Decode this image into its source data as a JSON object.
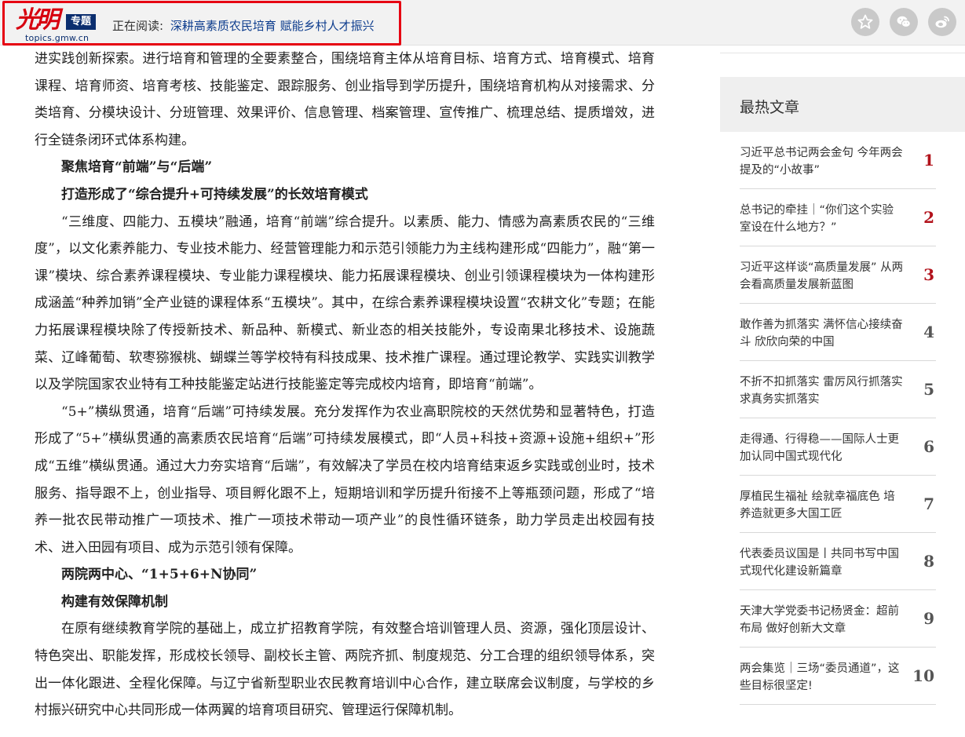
{
  "header": {
    "logo_calligraphy": "光明",
    "logo_tag": "专题",
    "logo_domain": "topics.gmw.cn",
    "reading_label": "正在阅读:",
    "reading_title": "深耕高素质农民培育 赋能乡村人才振兴",
    "share_icons": [
      "star-icon",
      "wechat-icon",
      "weibo-icon"
    ]
  },
  "article": {
    "paragraphs": [
      {
        "type": "text",
        "first": true,
        "text": "进实践创新探索。进行培育和管理的全要素整合，围绕培育主体从培育目标、培育方式、培育模式、培育课程、培育师资、培育考核、技能鉴定、跟踪服务、创业指导到学历提升，围绕培育机构从对接需求、分类培育、分模块设计、分班管理、效果评价、信息管理、档案管理、宣传推广、梳理总结、提质增效，进行全链条闭环式体系构建。"
      },
      {
        "type": "heading",
        "text": "聚焦培育“前端”与“后端”"
      },
      {
        "type": "heading",
        "text": "打造形成了“综合提升+可持续发展”的长效培育模式"
      },
      {
        "type": "text",
        "text": "“三维度、四能力、五模块”融通，培育“前端”综合提升。以素质、能力、情感为高素质农民的“三维度”，以文化素养能力、专业技术能力、经营管理能力和示范引领能力为主线构建形成“四能力”，融“第一课”模块、综合素养课程模块、专业能力课程模块、能力拓展课程模块、创业引领课程模块为一体构建形成涵盖“种养加销”全产业链的课程体系“五模块”。其中，在综合素养课程模块设置“农耕文化”专题；在能力拓展课程模块除了传授新技术、新品种、新模式、新业态的相关技能外，专设南果北移技术、设施蔬菜、辽峰葡萄、软枣猕猴桃、蝴蝶兰等学校特有科技成果、技术推广课程。通过理论教学、实践实训教学以及学院国家农业特有工种技能鉴定站进行技能鉴定等完成校内培育，即培育“前端”。"
      },
      {
        "type": "text",
        "text": "“5+”横纵贯通，培育“后端”可持续发展。充分发挥作为农业高职院校的天然优势和显著特色，打造形成了“5+”横纵贯通的高素质农民培育“后端”可持续发展模式，即“人员+科技+资源+设施+组织+”形成“五维”横纵贯通。通过大力夯实培育“后端”，有效解决了学员在校内培育结束返乡实践或创业时，技术服务、指导跟不上，创业指导、项目孵化跟不上，短期培训和学历提升衔接不上等瓶颈问题，形成了“培养一批农民带动推广一项技术、推广一项技术带动一项产业”的良性循环链条，助力学员走出校园有技术、进入田园有项目、成为示范引领有保障。"
      },
      {
        "type": "heading",
        "text": "两院两中心、“1+5+6+N协同”"
      },
      {
        "type": "heading",
        "text": "构建有效保障机制"
      },
      {
        "type": "text",
        "text": "在原有继续教育学院的基础上，成立扩招教育学院，有效整合培训管理人员、资源，强化顶层设计、特色突出、职能发挥，形成校长领导、副校长主管、两院齐抓、制度规范、分工合理的组织领导体系，突出一体化跟进、全程化保障。与辽宁省新型职业农民教育培训中心合作，建立联席会议制度，与学校的乡村振兴研究中心共同形成一体两翼的培育项目研究、管理运行保障机制。"
      }
    ]
  },
  "sidebar": {
    "hot_title": "最热文章",
    "items": [
      {
        "title": "习近平总书记两会金句 今年两会提及的“小故事”",
        "rank": "1"
      },
      {
        "title": "总书记的牵挂｜“你们这个实验室设在什么地方？”",
        "rank": "2"
      },
      {
        "title": "习近平这样谈“高质量发展” 从两会看高质量发展新蓝图",
        "rank": "3"
      },
      {
        "title": "敢作善为抓落实 满怀信心接续奋斗 欣欣向荣的中国",
        "rank": "4"
      },
      {
        "title": "不折不扣抓落实 雷厉风行抓落实 求真务实抓落实",
        "rank": "5"
      },
      {
        "title": "走得通、行得稳——国际人士更加认同中国式现代化",
        "rank": "6"
      },
      {
        "title": "厚植民生福祉 绘就幸福底色 培养造就更多大国工匠",
        "rank": "7"
      },
      {
        "title": "代表委员议国是丨共同书写中国式现代化建设新篇章",
        "rank": "8"
      },
      {
        "title": "天津大学党委书记杨贤金：超前布局 做好创新大文章",
        "rank": "9"
      },
      {
        "title": "两会集览｜三场“委员通道”，这些目标很坚定!",
        "rank": "10"
      }
    ]
  }
}
